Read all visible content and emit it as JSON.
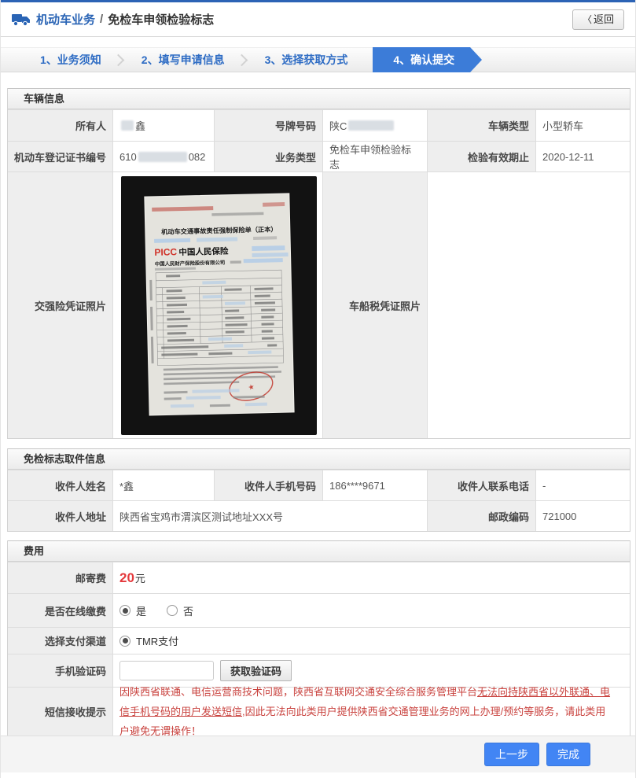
{
  "header": {
    "title": "机动车业务",
    "sep": "/",
    "subtitle": "免检车申领检验标志",
    "back_icon": "〈",
    "back_label": "返回"
  },
  "steps": {
    "s1": "1、业务须知",
    "s2": "2、填写申请信息",
    "s3": "3、选择获取方式",
    "s4": "4、确认提交"
  },
  "vehicle": {
    "title": "车辆信息",
    "owner_label": "所有人",
    "owner_value": "鑫",
    "plate_label": "号牌号码",
    "plate_prefix": "陕C",
    "type_label": "车辆类型",
    "type_value": "小型轿车",
    "reg_label": "机动车登记证书编号",
    "reg_prefix": "610",
    "reg_suffix": "082",
    "biz_label": "业务类型",
    "biz_value": "免检车申领检验标志",
    "valid_label": "检验有效期止",
    "valid_value": "2020-12-11",
    "ins_photo_label": "交强险凭证照片",
    "tax_photo_label": "车船税凭证照片",
    "photo": {
      "title": "机动车交通事故责任强制保险单（正本）",
      "brand": "PICC",
      "brand_cn": "中国人民保险",
      "company": "中国人民财产保险股份有限公司",
      "stamp_star": "★"
    }
  },
  "pickup": {
    "title": "免检标志取件信息",
    "name_label": "收件人姓名",
    "name_value": "*鑫",
    "phone_label": "收件人手机号码",
    "phone_value": "186****9671",
    "tel_label": "收件人联系电话",
    "tel_value": "-",
    "addr_label": "收件人地址",
    "addr_value": "陕西省宝鸡市渭滨区测试地址XXX号",
    "zip_label": "邮政编码",
    "zip_value": "721000"
  },
  "fee": {
    "title": "费用",
    "postage_label": "邮寄费",
    "postage_value": "20",
    "postage_unit": "元",
    "online_label": "是否在线缴费",
    "yes_label": "是",
    "no_label": "否",
    "channel_label": "选择支付渠道",
    "channel_value": "TMR支付",
    "code_label": "手机验证码",
    "get_code_label": "获取验证码",
    "sms_label": "短信接收提示",
    "sms_part1": "因陕西省联通、电信运营商技术问题，陕西省互联网交通安全综合服务管理平台",
    "sms_underline": "无法向持陕西省以外联通、电信手机号码的用户发送短信",
    "sms_part2": ",因此无法向此类用户提供陕西省交通管理业务的网上办理/预约等服务，请此类用户避免无谓操作！"
  },
  "footer": {
    "prev_label": "上一步",
    "done_label": "完成"
  },
  "colors": {
    "brand_blue": "#2c63b5",
    "step_active_blue": "#3c7cd8",
    "button_blue": "#4285f4",
    "price_red": "#e4393c",
    "sms_red": "#c9433f"
  }
}
